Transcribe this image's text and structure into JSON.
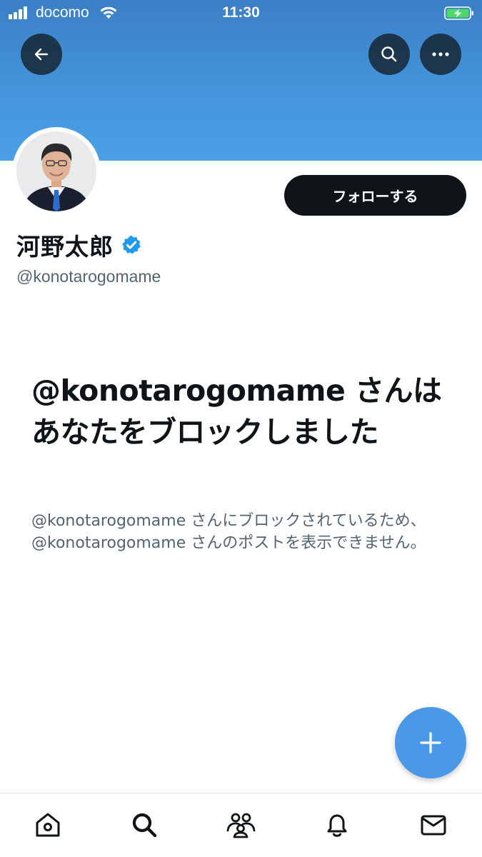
{
  "status_bar": {
    "carrier": "docomo",
    "time": "11:30"
  },
  "header": {
    "back_icon": "arrow-left-icon",
    "search_icon": "search-icon",
    "more_icon": "more-horizontal-icon",
    "banner_color": "#4596dc"
  },
  "profile": {
    "display_name": "河野太郎",
    "verified": true,
    "verified_color": "#1d9bf0",
    "handle": "@konotarogomame",
    "follow_label": "フォローする"
  },
  "blocked": {
    "title": "@konotarogomame さんはあなたをブロックしました",
    "description": "@konotarogomame さんにブロックされているため、@konotarogomame さんのポストを表示できません。"
  },
  "fab": {
    "icon": "plus-icon",
    "color": "#4a99e9"
  },
  "tab_bar": {
    "items": [
      {
        "name": "home",
        "icon": "home-icon"
      },
      {
        "name": "search",
        "icon": "search-icon"
      },
      {
        "name": "communities",
        "icon": "communities-icon"
      },
      {
        "name": "notifications",
        "icon": "bell-icon"
      },
      {
        "name": "messages",
        "icon": "mail-icon"
      }
    ]
  }
}
